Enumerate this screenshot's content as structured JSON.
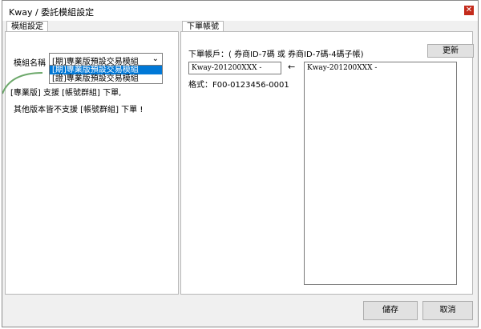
{
  "window": {
    "title": "Kway / 委託模組設定",
    "close_glyph": "✕"
  },
  "left_tab": {
    "label": "模組設定",
    "module_name_label": "模組名稱",
    "combo_value": "[期]專業版預設交易模組",
    "options": [
      "[期]專業版預設交易模組",
      "[證]專業版預設交易模組"
    ],
    "selected_option": 0,
    "note_line1": "[專業版] 支援 [帳號群組] 下單,",
    "note_line2": "其他版本皆不支援 [帳號群組] 下單 !"
  },
  "right_tab": {
    "label": "下單帳號",
    "instruction": "下單帳戶：( 券商ID-7碼 或 券商ID-7碼-4碼子帳)",
    "refresh_button": "更新",
    "account_input_value": "Kway-201200XXX -",
    "arrow_glyph": "←",
    "format_hint": "格式：F00-0123456-0001",
    "account_list_items": [
      "Kway-201200XXX -"
    ]
  },
  "footer": {
    "save_button": "儲存",
    "cancel_button": "取消"
  },
  "colors": {
    "selection": "#0078d7",
    "close": "#c42b1c",
    "arc": "#6ca86a"
  }
}
